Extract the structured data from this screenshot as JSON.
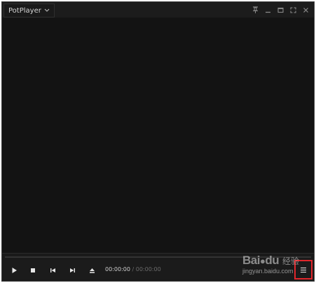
{
  "app": {
    "title": "PotPlayer"
  },
  "window_controls": [
    {
      "name": "pin-icon"
    },
    {
      "name": "minimize-icon"
    },
    {
      "name": "maximize-icon"
    },
    {
      "name": "fullscreen-icon"
    },
    {
      "name": "close-icon"
    }
  ],
  "playback": {
    "current_time": "00:00:00",
    "separator": "/",
    "total_time": "00:00:00"
  },
  "controls": [
    {
      "name": "play-icon"
    },
    {
      "name": "stop-icon"
    },
    {
      "name": "previous-icon"
    },
    {
      "name": "next-icon"
    },
    {
      "name": "eject-icon"
    },
    {
      "name": "menu-icon"
    }
  ],
  "watermark": {
    "logo_text": "Bai",
    "logo_suffix": "du",
    "logo_cn": "经验",
    "url": "jingyan.baidu.com"
  },
  "colors": {
    "window_bg": "#121212",
    "titlebar_bg": "#1c1c1c",
    "highlight_box": "#e0262b"
  }
}
